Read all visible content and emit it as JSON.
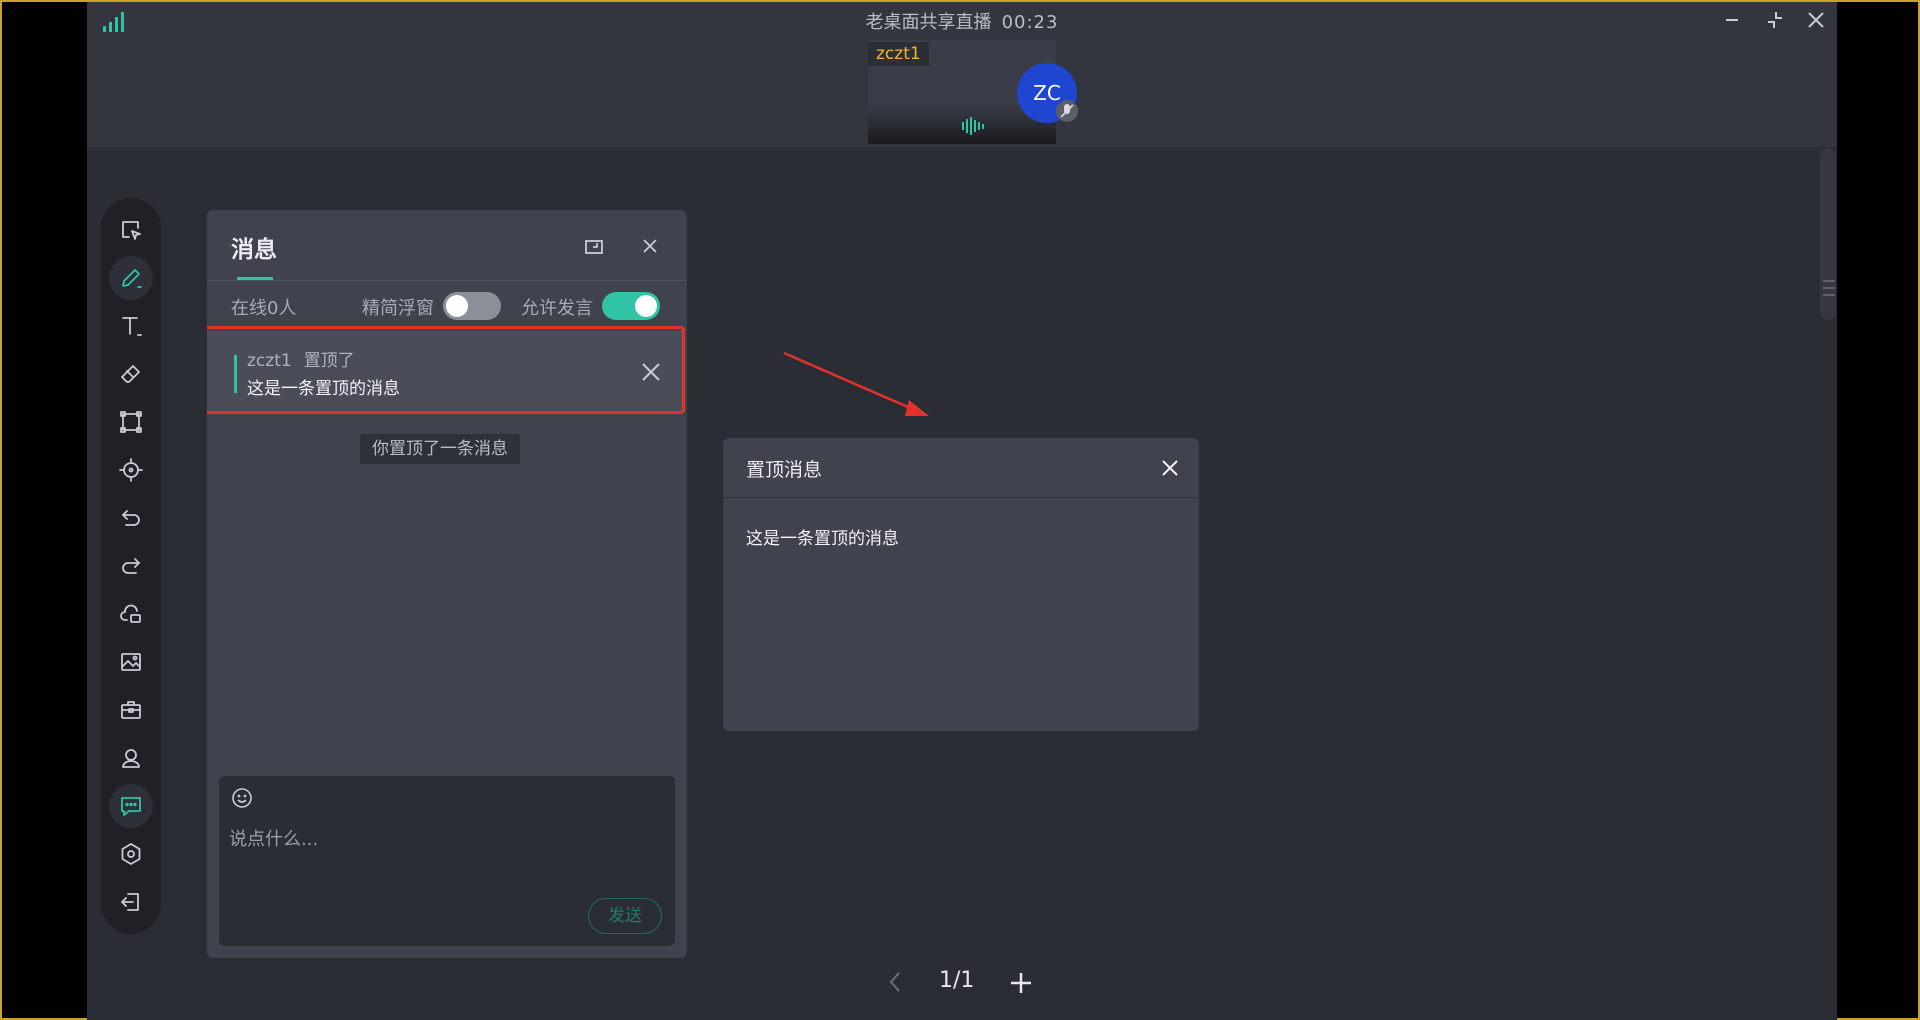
{
  "window": {
    "title": "老桌面共享直播",
    "timer": "00:23"
  },
  "colors": {
    "accent": "#2ec4a4",
    "annotation_red": "#e5312d",
    "username_orange": "#f2b138",
    "avatar_blue": "#1f46d1"
  },
  "video_tile": {
    "username": "zczt1",
    "avatar_initials": "ZC"
  },
  "toolbar": {
    "items": [
      {
        "name": "select",
        "icon": "cursor-select-icon"
      },
      {
        "name": "pen",
        "icon": "pen-icon",
        "active": true
      },
      {
        "name": "text",
        "icon": "text-icon"
      },
      {
        "name": "eraser",
        "icon": "eraser-icon"
      },
      {
        "name": "shape",
        "icon": "shape-icon"
      },
      {
        "name": "laser",
        "icon": "laser-pointer-icon"
      },
      {
        "name": "undo",
        "icon": "undo-icon"
      },
      {
        "name": "redo",
        "icon": "redo-icon"
      },
      {
        "name": "cloud-files",
        "icon": "cloud-file-icon"
      },
      {
        "name": "image",
        "icon": "image-icon"
      },
      {
        "name": "toolbox",
        "icon": "toolbox-icon"
      },
      {
        "name": "members",
        "icon": "user-icon"
      },
      {
        "name": "chat",
        "icon": "chat-icon",
        "active": true
      },
      {
        "name": "settings",
        "icon": "settings-icon"
      },
      {
        "name": "exit",
        "icon": "exit-icon"
      }
    ]
  },
  "message_panel": {
    "title": "消息",
    "online_count": "在线0人",
    "compact_float_label": "精简浮窗",
    "compact_float_on": false,
    "allow_speak_label": "允许发言",
    "allow_speak_on": true,
    "pinned": {
      "user": "zczt1",
      "action": "置顶了",
      "text": "这是一条置顶的消息"
    },
    "system_notice": "你置顶了一条消息",
    "input_placeholder": "说点什么...",
    "send_label": "发送"
  },
  "pin_dialog": {
    "title": "置顶消息",
    "body": "这是一条置顶的消息"
  },
  "pager": {
    "label": "1/1"
  }
}
